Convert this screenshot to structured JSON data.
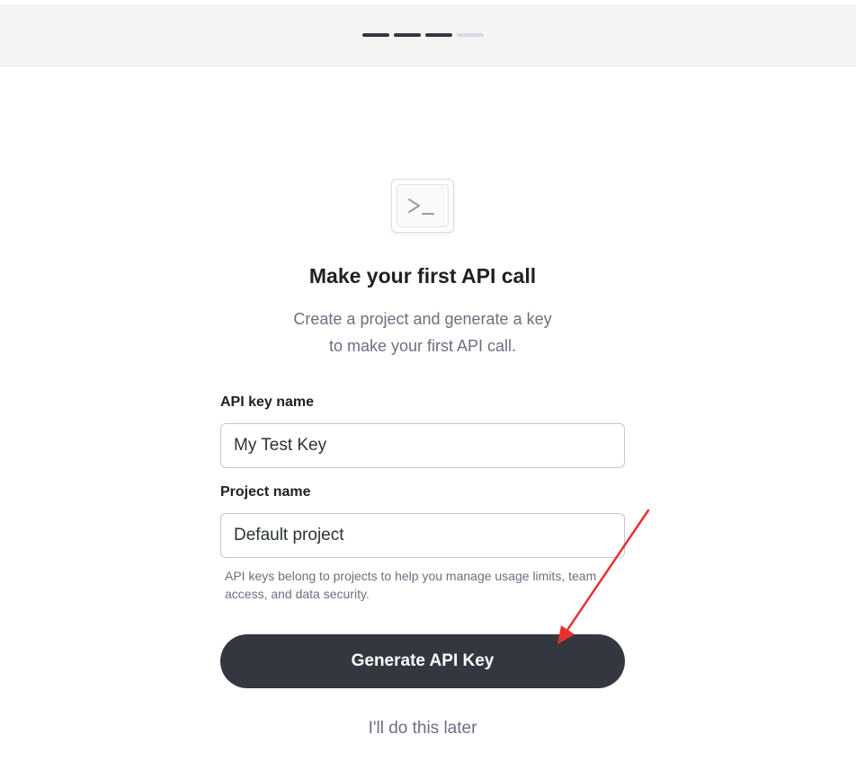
{
  "progress": {
    "total_steps": 4,
    "completed_steps": 3,
    "active_color": "#353740",
    "inactive_color": "#d9d9e3"
  },
  "hero": {
    "icon": "terminal-icon",
    "title": "Make your first API call",
    "subtitle": "Create a project and generate a key to make your first API call."
  },
  "form": {
    "api_key_label": "API key name",
    "api_key_value": "My Test Key",
    "project_label": "Project name",
    "project_value": "Default project",
    "helper_text": "API keys belong to projects to help you manage usage limits, team access, and data security."
  },
  "actions": {
    "generate_label": "Generate API Key",
    "later_label": "I'll do this later"
  },
  "colors": {
    "primary_button": "#353740",
    "annotation_arrow": "#e8312f"
  }
}
